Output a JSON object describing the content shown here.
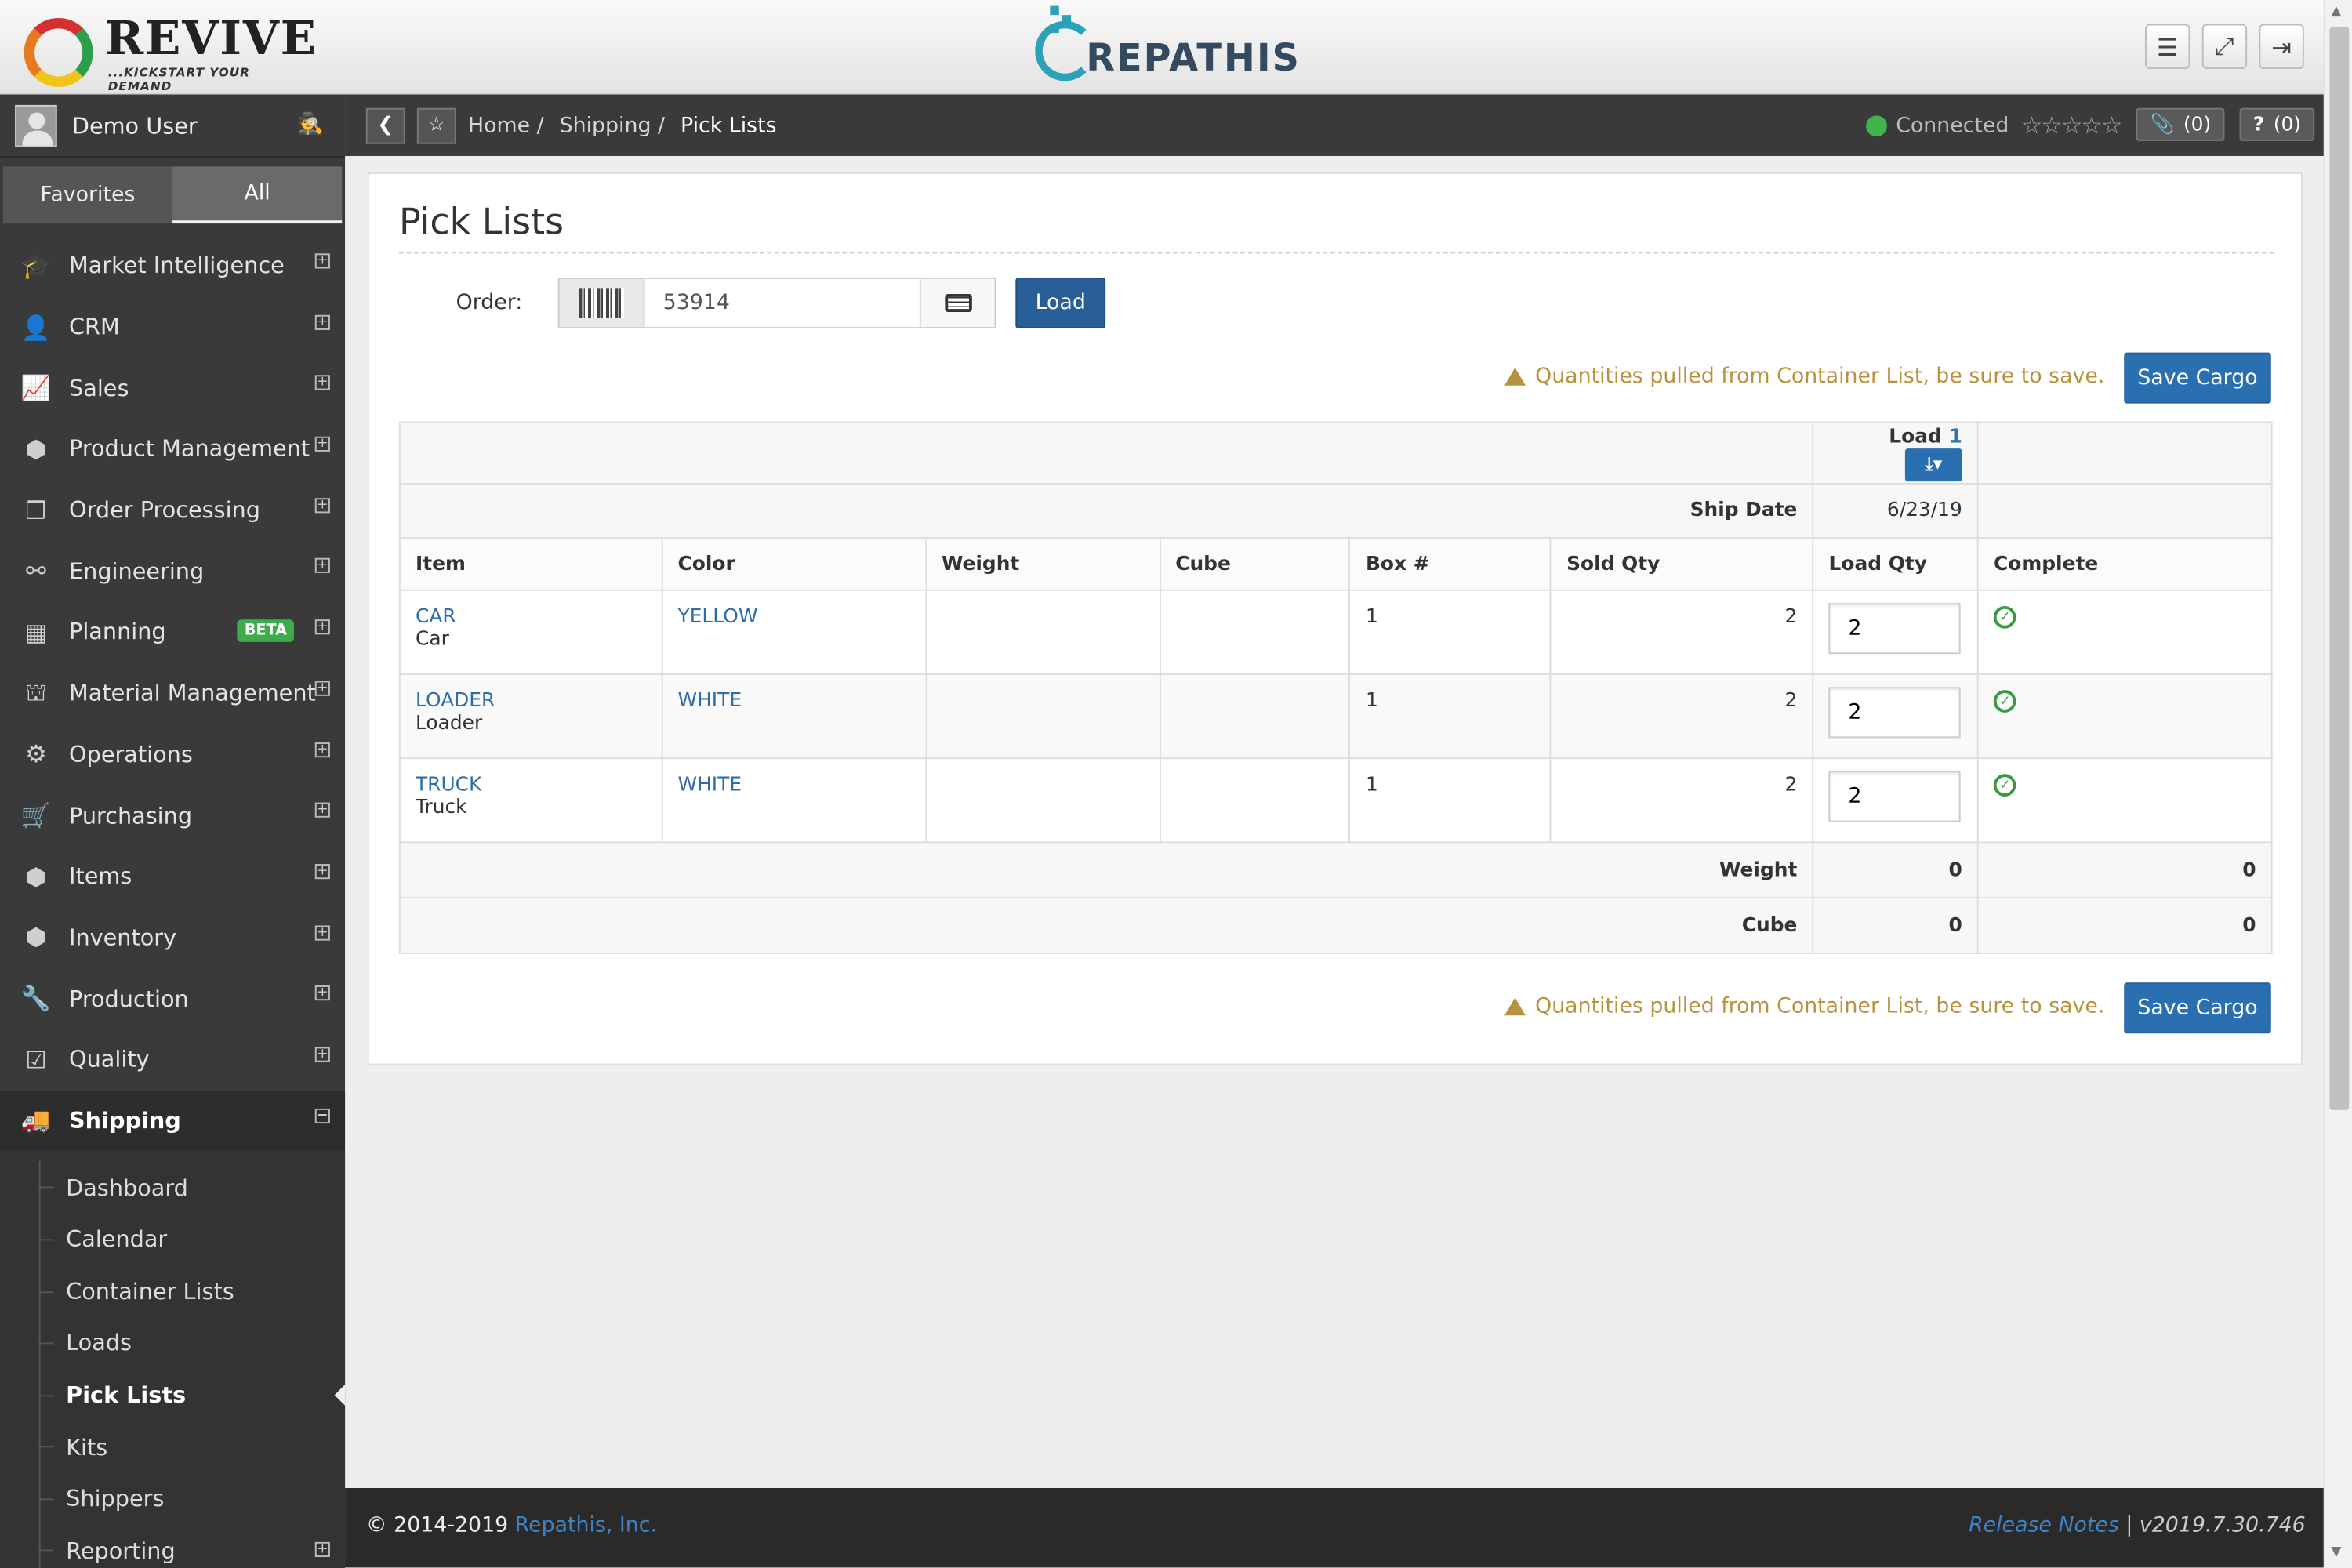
{
  "header": {
    "company_logo": "REVIVE",
    "company_tagline": "...KICKSTART YOUR DEMAND",
    "app_logo": "REPATHIS",
    "buttons": [
      "menu-icon",
      "expand-icon",
      "sign-out-icon"
    ]
  },
  "sidebar": {
    "user_name": "Demo User",
    "tabs": {
      "favorites": "Favorites",
      "all": "All"
    },
    "items": [
      {
        "label": "Market Intelligence",
        "icon": "graduation-cap-icon"
      },
      {
        "label": "CRM",
        "icon": "user-icon"
      },
      {
        "label": "Sales",
        "icon": "line-chart-icon"
      },
      {
        "label": "Product Management",
        "icon": "cube-icon"
      },
      {
        "label": "Order Processing",
        "icon": "copy-icon"
      },
      {
        "label": "Engineering",
        "icon": "link-icon"
      },
      {
        "label": "Planning",
        "icon": "calendar-icon",
        "badge": "BETA"
      },
      {
        "label": "Material Management",
        "icon": "sitemap-icon"
      },
      {
        "label": "Operations",
        "icon": "gears-icon"
      },
      {
        "label": "Purchasing",
        "icon": "cart-icon"
      },
      {
        "label": "Items",
        "icon": "cubes-icon"
      },
      {
        "label": "Inventory",
        "icon": "cubes-icon"
      },
      {
        "label": "Production",
        "icon": "wrench-icon"
      },
      {
        "label": "Quality",
        "icon": "check-square-icon"
      },
      {
        "label": "Shipping",
        "icon": "truck-icon",
        "active": true
      }
    ],
    "shipping_sub": [
      "Dashboard",
      "Calendar",
      "Container Lists",
      "Loads",
      "Pick Lists",
      "Kits",
      "Shippers",
      "Reporting"
    ]
  },
  "breadcrumb": {
    "home": "Home",
    "shipping": "Shipping",
    "current": "Pick Lists",
    "sep": "/",
    "status": "Connected",
    "rating": "☆☆☆☆☆",
    "attachments": "(0)",
    "help": "(0)"
  },
  "page": {
    "title": "Pick Lists",
    "order_label": "Order:",
    "order_value": "53914",
    "load_button": "Load",
    "warning": "Quantities pulled from Container List, be sure to save.",
    "save_button": "Save Cargo"
  },
  "table": {
    "load_label": "Load",
    "load_number": "1",
    "ship_date_label": "Ship Date",
    "ship_date": "6/23/19",
    "columns": [
      "Item",
      "Color",
      "Weight",
      "Cube",
      "Box #",
      "Sold Qty",
      "Load Qty",
      "Complete"
    ],
    "rows": [
      {
        "item": "CAR",
        "desc": "Car",
        "color": "YELLOW",
        "weight": "",
        "cube": "",
        "box": "1",
        "sold": "2",
        "load": "2"
      },
      {
        "item": "LOADER",
        "desc": "Loader",
        "color": "WHITE",
        "weight": "",
        "cube": "",
        "box": "1",
        "sold": "2",
        "load": "2"
      },
      {
        "item": "TRUCK",
        "desc": "Truck",
        "color": "WHITE",
        "weight": "",
        "cube": "",
        "box": "1",
        "sold": "2",
        "load": "2"
      }
    ],
    "totals": [
      {
        "label": "Weight",
        "load": "0",
        "complete": "0"
      },
      {
        "label": "Cube",
        "load": "0",
        "complete": "0"
      }
    ]
  },
  "footer": {
    "copyright": "© 2014-2019",
    "company": "Repathis, Inc.",
    "release_notes": "Release Notes",
    "divider": "|",
    "version": "v2019.7.30.746"
  }
}
